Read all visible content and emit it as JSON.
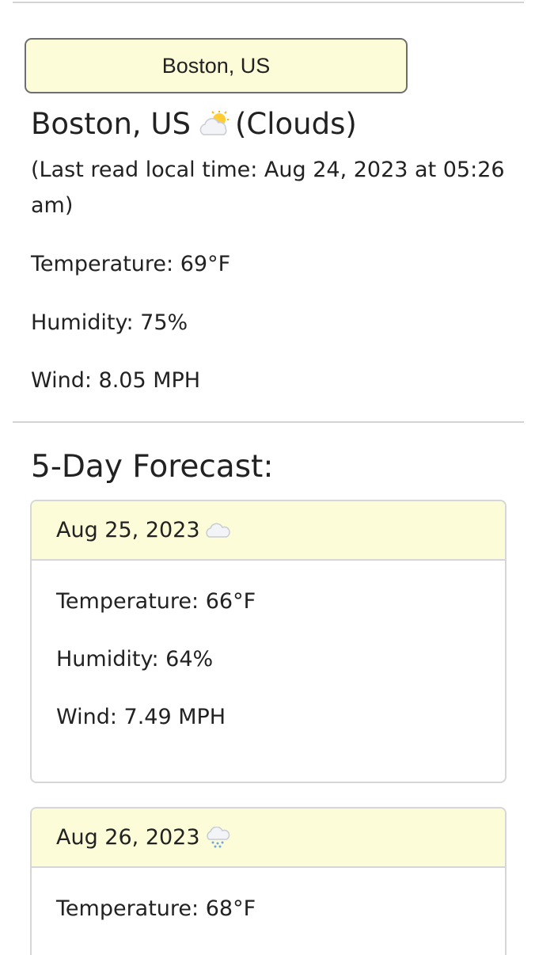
{
  "search": {
    "city_button_label": "Boston, US"
  },
  "current": {
    "city": "Boston, US",
    "condition": "(Clouds)",
    "icon": "cloud-sun-icon",
    "last_read": "(Last read local time: Aug 24, 2023 at 05:26 am)",
    "temperature": "Temperature: 69°F",
    "humidity": "Humidity: 75%",
    "wind": "Wind: 8.05 MPH"
  },
  "forecast": {
    "heading": "5-Day Forecast:",
    "days": [
      {
        "date": "Aug 25, 2023",
        "icon": "cloud-icon",
        "temperature": "Temperature: 66°F",
        "humidity": "Humidity: 64%",
        "wind": "Wind: 7.49 MPH"
      },
      {
        "date": "Aug 26, 2023",
        "icon": "rain-cloud-icon",
        "temperature": "Temperature: 68°F"
      }
    ]
  },
  "colors": {
    "header_bg": "#fcfcd8",
    "border": "#d6d6d6",
    "text": "#222222"
  }
}
